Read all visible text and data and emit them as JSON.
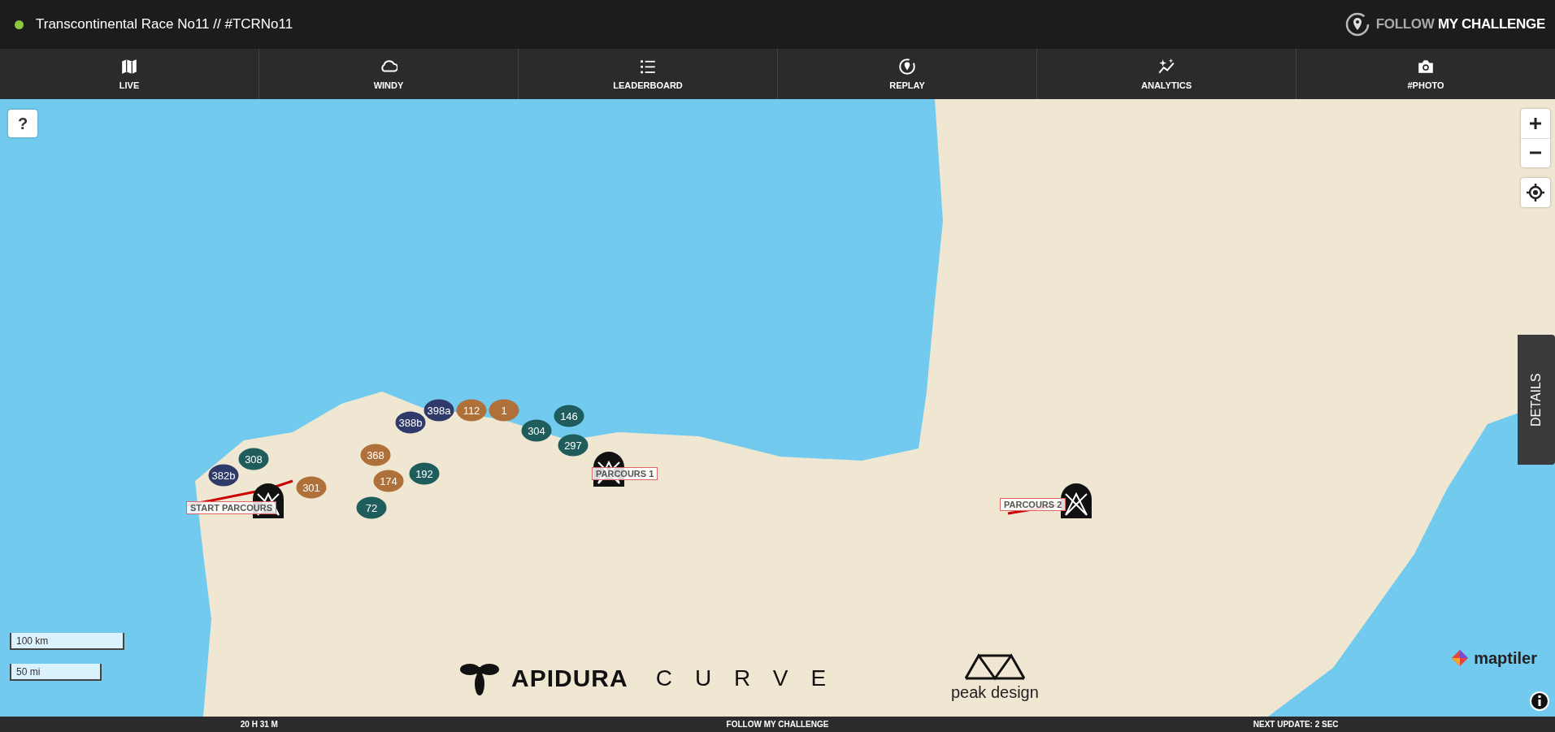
{
  "header": {
    "online": true,
    "title": "Transcontinental Race No11 // #TCRNo11",
    "brand": "FOLLOW **MY CHALLENGE**"
  },
  "tabs": [
    {
      "label": "LIVE",
      "selected": false
    },
    {
      "label": "WINDY",
      "selected": false
    },
    {
      "label": "LEADERBOARD",
      "selected": false
    },
    {
      "label": "REPLAY",
      "selected": false
    },
    {
      "label": "ANALYTICS",
      "selected": false
    },
    {
      "label": "#PHOTO",
      "selected": false
    }
  ],
  "map": {
    "help": "?",
    "details": "DETAILS",
    "checkpoints": [
      {
        "label": "START PARCOURS"
      },
      {
        "label": "PARCOURS 1"
      },
      {
        "label": "PARCOURS 2"
      }
    ],
    "riders": [
      {
        "label": "382b",
        "color": "#2f3a6b"
      },
      {
        "label": "308",
        "color": "#1f5c5c"
      },
      {
        "label": "301",
        "color": "#b0703a"
      },
      {
        "label": "72",
        "color": "#1f5c5c"
      },
      {
        "label": "368",
        "color": "#b0703a"
      },
      {
        "label": "174",
        "color": "#b0703a"
      },
      {
        "label": "388b",
        "color": "#2f3a6b"
      },
      {
        "label": "192",
        "color": "#1f5c5c"
      },
      {
        "label": "398a",
        "color": "#2f3a6b"
      },
      {
        "label": "112",
        "color": "#b0703a"
      },
      {
        "label": "1",
        "color": "#b0703a"
      },
      {
        "label": "304",
        "color": "#1f5c5c"
      },
      {
        "label": "146",
        "color": "#1f5c5c"
      },
      {
        "label": "297",
        "color": "#1f5c5c"
      }
    ],
    "scale": [
      "100 km",
      "50 mi"
    ],
    "sponsors": [
      "APIDURA",
      "CURVE",
      "peak design"
    ],
    "attribution": "maptiler"
  },
  "footer": {
    "elapsed": "20 H 31 M",
    "center": "FOLLOW MY CHALLENGE",
    "next_update": "NEXT UPDATE: 2 SEC"
  }
}
